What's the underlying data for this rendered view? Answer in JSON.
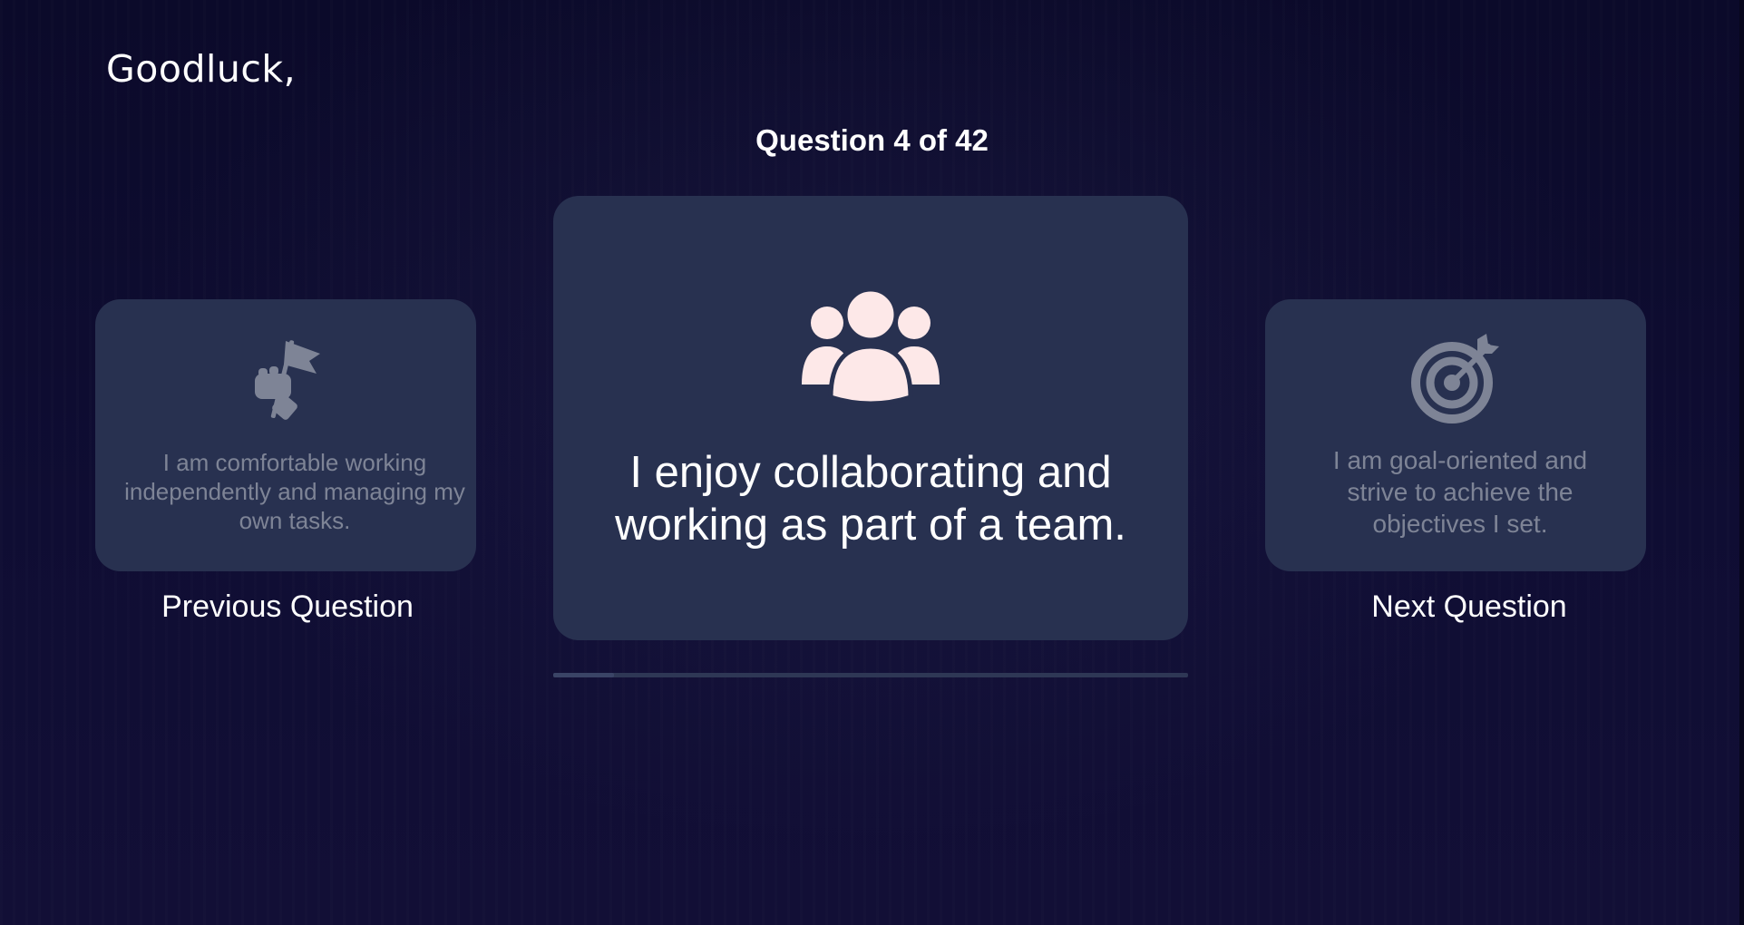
{
  "greeting": "Goodluck,",
  "counter": "Question 4 of 42",
  "progress": 0.095,
  "previous": {
    "text": "I am comfortable working independently and managing my own tasks.",
    "icon": "hand-holding-flag-icon",
    "nav_label": "Previous Question"
  },
  "current": {
    "text": "I enjoy collaborating and working as part of a team.",
    "icon": "group-users-icon"
  },
  "next": {
    "text": "I am goal-oriented and strive to achieve the objectives I set.",
    "icon": "target-arrow-icon",
    "nav_label": "Next Question"
  },
  "colors": {
    "background": "#0c0b2b",
    "card": "#283150",
    "main_icon": "#fde8e8",
    "side_icon": "#7e8496",
    "side_text": "#7e8496"
  }
}
